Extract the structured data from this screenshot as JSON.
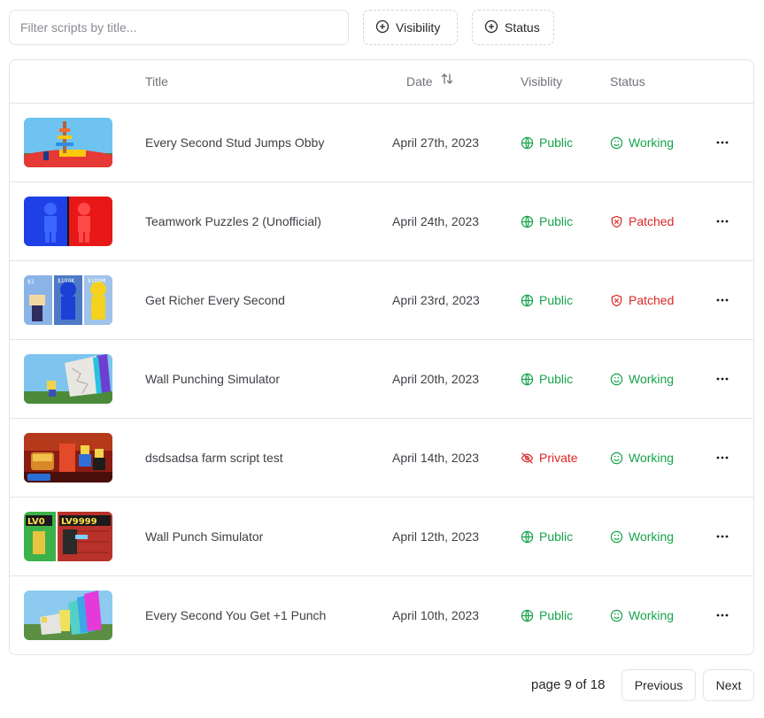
{
  "filters": {
    "search_placeholder": "Filter scripts by title...",
    "visibility_label": "Visibility",
    "status_label": "Status"
  },
  "table": {
    "headers": {
      "title": "Title",
      "date": "Date",
      "visibility": "Visiblity",
      "status": "Status"
    },
    "rows": [
      {
        "title": "Every Second Stud Jumps Obby",
        "date": "April 27th, 2023",
        "visibility": "Public",
        "status": "Working"
      },
      {
        "title": "Teamwork Puzzles 2 (Unofficial)",
        "date": "April 24th, 2023",
        "visibility": "Public",
        "status": "Patched"
      },
      {
        "title": "Get Richer Every Second",
        "date": "April 23rd, 2023",
        "visibility": "Public",
        "status": "Patched"
      },
      {
        "title": "Wall Punching Simulator",
        "date": "April 20th, 2023",
        "visibility": "Public",
        "status": "Working"
      },
      {
        "title": "dsdsadsa farm script test",
        "date": "April 14th, 2023",
        "visibility": "Private",
        "status": "Working"
      },
      {
        "title": "Wall Punch Simulator",
        "date": "April 12th, 2023",
        "visibility": "Public",
        "status": "Working"
      },
      {
        "title": "Every Second You Get +1 Punch",
        "date": "April 10th, 2023",
        "visibility": "Public",
        "status": "Working"
      }
    ]
  },
  "pagination": {
    "label": "page 9 of 18",
    "previous": "Previous",
    "next": "Next"
  },
  "colors": {
    "green": "#16a34a",
    "red": "#dc2626",
    "border": "#e4e4e7"
  },
  "icons": {
    "filter": "plus-circle-icon",
    "sort": "sort-arrows-icon",
    "public": "globe-icon",
    "private": "eye-off-icon",
    "working": "smile-icon",
    "patched": "shield-x-icon",
    "more": "ellipsis-icon"
  }
}
